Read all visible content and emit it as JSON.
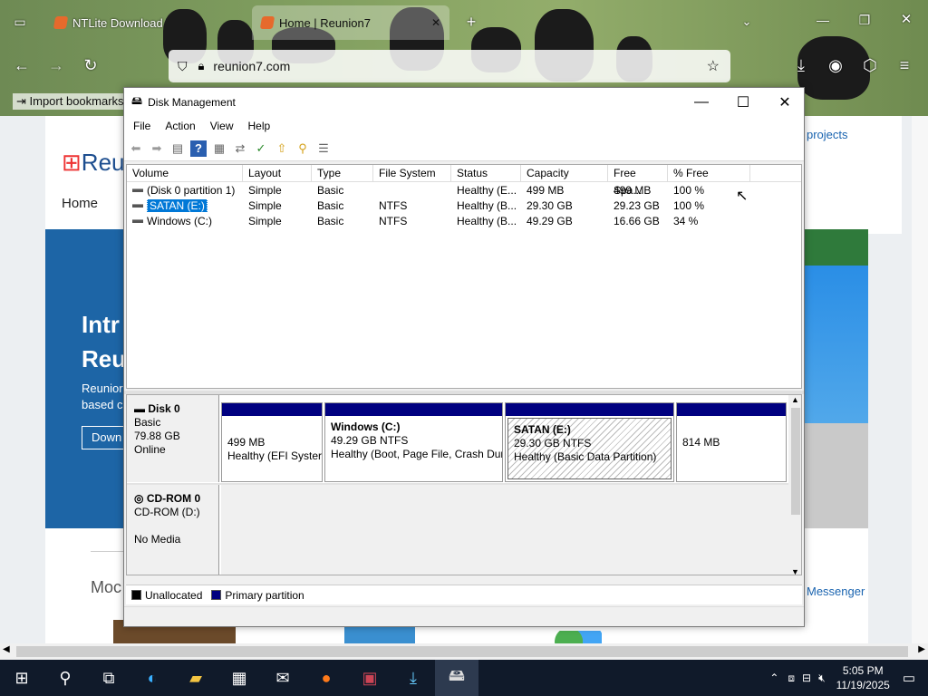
{
  "browser": {
    "tabs": [
      {
        "title": "NTLite Download",
        "active": false
      },
      {
        "title": "Home | Reunion7",
        "active": true
      }
    ],
    "url": "reunion7.com",
    "bookmark": "Import bookmarks..."
  },
  "webpage": {
    "logo_text": "Reu",
    "nav_home": "Home",
    "projects": "projects",
    "hero_title_1": "Intr",
    "hero_title_2": "Reu",
    "hero_para_1": "Reunior",
    "hero_para_2": "based c",
    "download_btn": "Down",
    "mod_text": "Moc",
    "messenger": "Messenger"
  },
  "disk_management": {
    "title": "Disk Management",
    "menu": [
      "File",
      "Action",
      "View",
      "Help"
    ],
    "columns": [
      "Volume",
      "Layout",
      "Type",
      "File System",
      "Status",
      "Capacity",
      "Free Spa...",
      "% Free"
    ],
    "volumes": [
      {
        "volume": "(Disk 0 partition 1)",
        "layout": "Simple",
        "type": "Basic",
        "fs": "",
        "status": "Healthy (E...",
        "capacity": "499 MB",
        "free": "499 MB",
        "pct": "100 %"
      },
      {
        "volume": "SATAN (E:)",
        "layout": "Simple",
        "type": "Basic",
        "fs": "NTFS",
        "status": "Healthy (B...",
        "capacity": "29.30 GB",
        "free": "29.23 GB",
        "pct": "100 %"
      },
      {
        "volume": "Windows (C:)",
        "layout": "Simple",
        "type": "Basic",
        "fs": "NTFS",
        "status": "Healthy (B...",
        "capacity": "49.29 GB",
        "free": "16.66 GB",
        "pct": "34 %"
      }
    ],
    "disk0": {
      "name": "Disk 0",
      "type": "Basic",
      "size": "79.88 GB",
      "state": "Online",
      "partitions": [
        {
          "name": "",
          "line1": "499 MB",
          "line2": "Healthy (EFI Syster"
        },
        {
          "name": "Windows  (C:)",
          "line1": "49.29 GB NTFS",
          "line2": "Healthy (Boot, Page File, Crash Dur"
        },
        {
          "name": "SATAN  (E:)",
          "line1": "29.30 GB NTFS",
          "line2": "Healthy (Basic Data Partition)"
        },
        {
          "name": "",
          "line1": "814 MB",
          "line2": ""
        }
      ]
    },
    "cdrom0": {
      "name": "CD-ROM 0",
      "drive": "CD-ROM (D:)",
      "media": "No Media"
    },
    "legend": [
      {
        "label": "Unallocated",
        "color": "#000000"
      },
      {
        "label": "Primary partition",
        "color": "#000080"
      }
    ]
  },
  "taskbar": {
    "time": "5:05 PM",
    "date": "11/19/2025"
  }
}
